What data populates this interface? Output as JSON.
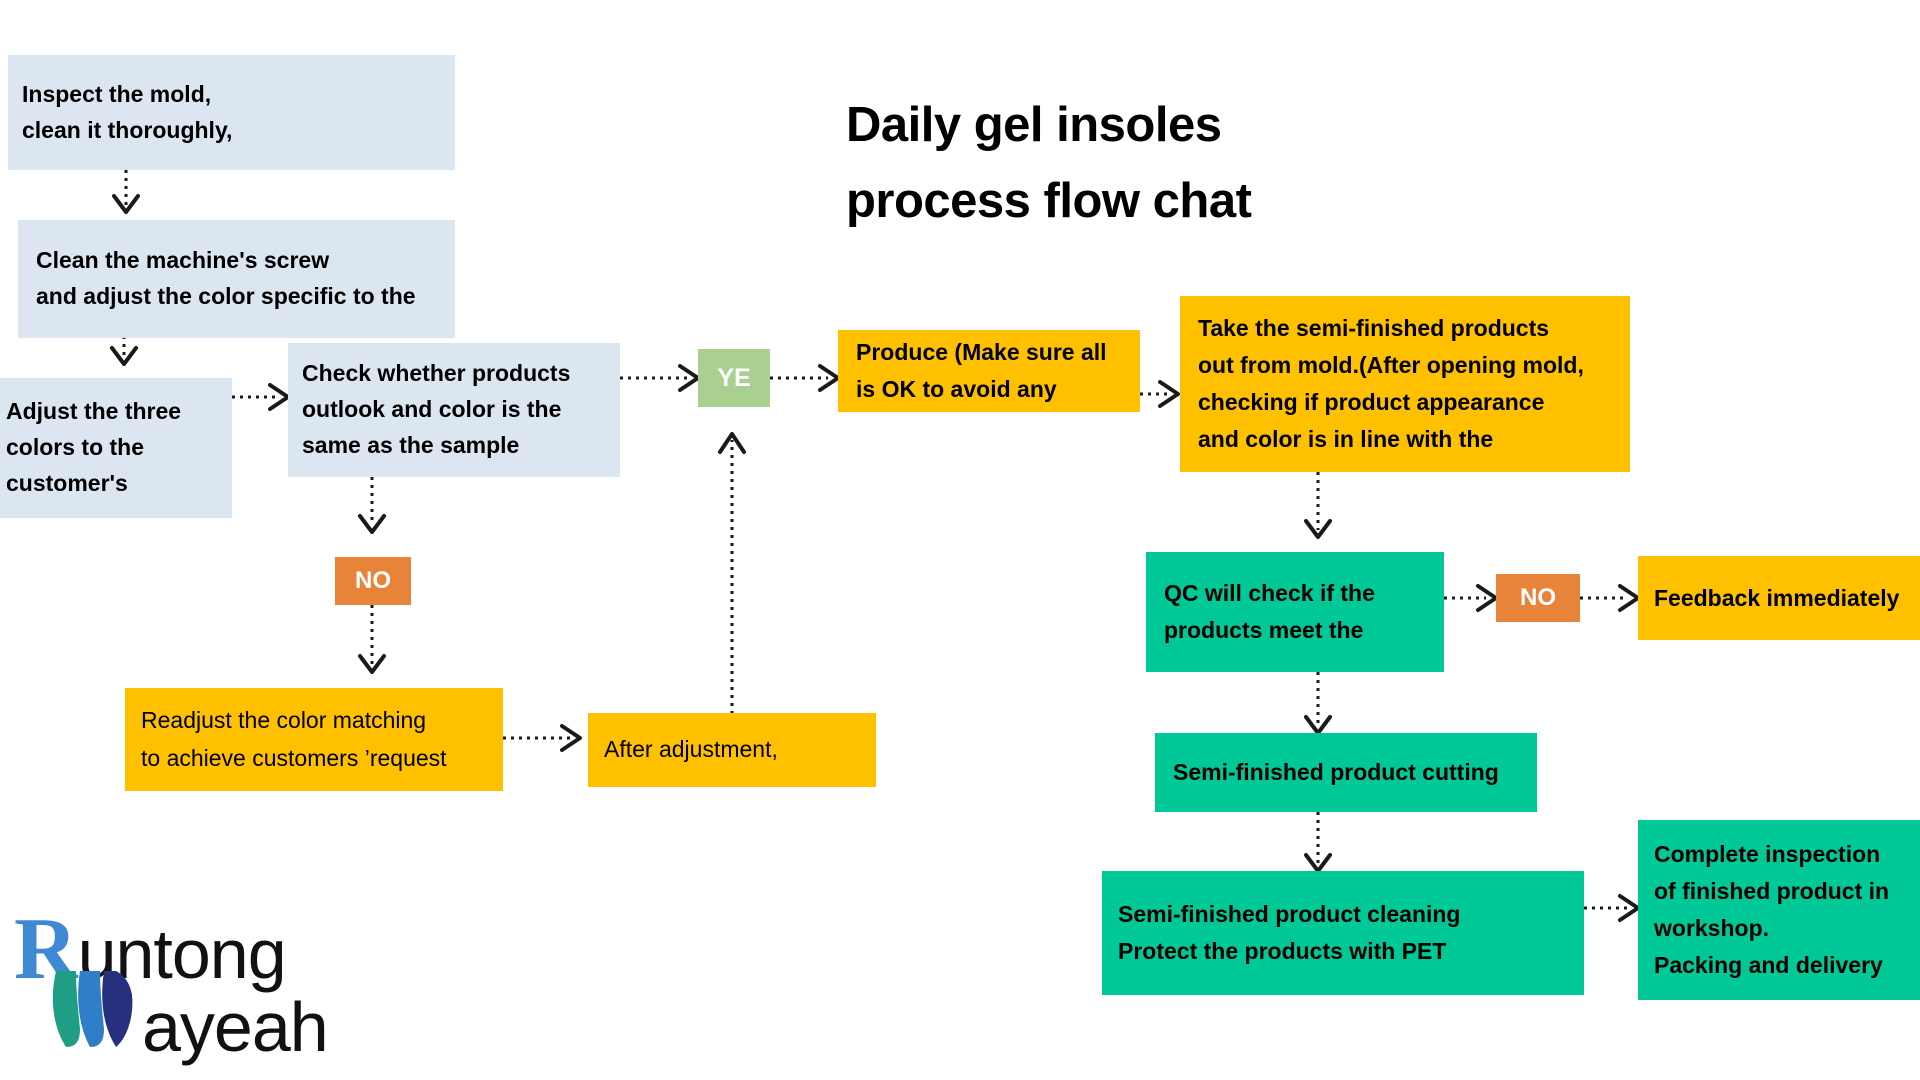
{
  "title": {
    "text": "Daily gel insoles\nprocess flow chat"
  },
  "colors": {
    "light_blue": "#dce6f1",
    "amber": "#ffc000",
    "teal": "#00c896",
    "green": "#a9cf91",
    "orange": "#e8833a",
    "text": "#000000",
    "logo_blue": "#3f88d4",
    "logo_teal": "#1f9e86",
    "logo_mid_blue": "#2e7ec8",
    "logo_navy": "#26307e"
  },
  "nodes": [
    {
      "id": "inspect-mold",
      "label": "Inspect the mold,\nclean it thoroughly,"
    },
    {
      "id": "clean-screw",
      "label": "Clean the machine's screw\nand adjust the color specific to the"
    },
    {
      "id": "adjust-three-colors",
      "label": "Adjust the three\ncolors to the\ncustomer's"
    },
    {
      "id": "check-outlook",
      "label": "Check whether products\noutlook and color is the\nsame as the sample"
    },
    {
      "id": "decision-no-left",
      "label": "NO"
    },
    {
      "id": "readjust-color",
      "label": "Readjust the color matching\nto achieve customers  ’request"
    },
    {
      "id": "after-adjustment",
      "label": "After adjustment,"
    },
    {
      "id": "decision-yes",
      "label": "YE"
    },
    {
      "id": "produce",
      "label": "Produce  (Make sure all\nis OK to avoid any"
    },
    {
      "id": "take-semi-finished",
      "label": "Take the semi-finished products\nout from mold.(After opening mold,\nchecking if product appearance\nand color is in line with the"
    },
    {
      "id": "qc-check",
      "label": "QC will check if the\nproducts meet the"
    },
    {
      "id": "decision-no-right",
      "label": "NO"
    },
    {
      "id": "feedback",
      "label": "Feedback immediately"
    },
    {
      "id": "semi-cutting",
      "label": "Semi-finished product cutting"
    },
    {
      "id": "semi-cleaning",
      "label": "Semi-finished product cleaning\nProtect the products with PET"
    },
    {
      "id": "complete-inspection",
      "label": "Complete inspection\nof finished product in\nworkshop.\nPacking and delivery"
    }
  ],
  "logo": {
    "initial": "R",
    "word1": "untong",
    "word2": "ayeah"
  }
}
